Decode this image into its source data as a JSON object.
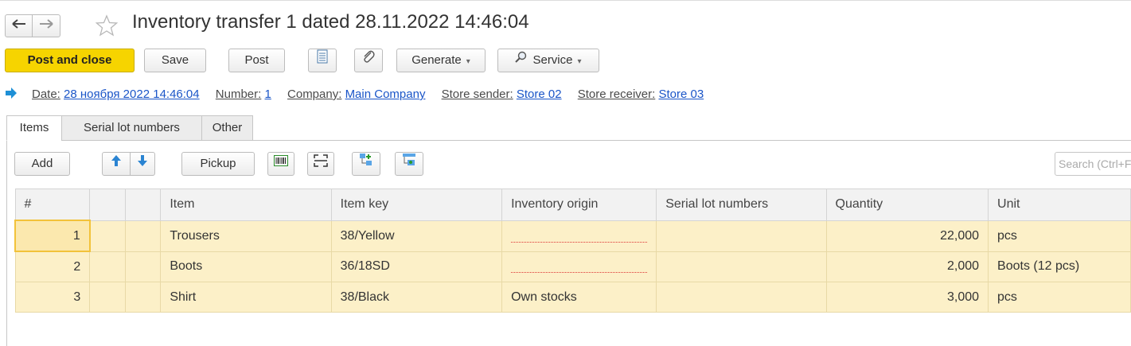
{
  "window": {
    "title": "Inventory transfer 1 dated 28.11.2022 14:46:04"
  },
  "nav": {
    "back_icon": "arrow-left-icon",
    "forward_icon": "arrow-right-icon",
    "favorite_icon": "star-icon"
  },
  "toolbar": {
    "post_and_close": "Post and close",
    "save": "Save",
    "post": "Post",
    "generate": "Generate",
    "service": "Service",
    "report_icon": "document-list-icon",
    "attach_icon": "paperclip-icon",
    "service_icon": "search-icon"
  },
  "header": {
    "date_label": "Date:",
    "date_value": "28 ноября 2022 14:46:04",
    "number_label": "Number:",
    "number_value": "1",
    "company_label": "Company:",
    "company_value": "Main Company",
    "sender_label": "Store sender:",
    "sender_value": "Store 02",
    "receiver_label": "Store receiver:",
    "receiver_value": "Store 03"
  },
  "tabs": [
    {
      "label": "Items",
      "active": true
    },
    {
      "label": "Serial lot numbers",
      "active": false
    },
    {
      "label": "Other",
      "active": false
    }
  ],
  "items_toolbar": {
    "add": "Add",
    "pickup": "Pickup",
    "search_placeholder": "Search (Ctrl+F)"
  },
  "table": {
    "columns": [
      "#",
      "",
      "",
      "Item",
      "Item key",
      "Inventory origin",
      "Serial lot numbers",
      "Quantity",
      "Unit"
    ],
    "rows": [
      {
        "n": "1",
        "item": "Trousers",
        "key": "38/Yellow",
        "origin": "",
        "serial": "",
        "qty": "22,000",
        "unit": "pcs"
      },
      {
        "n": "2",
        "item": "Boots",
        "key": "36/18SD",
        "origin": "",
        "serial": "",
        "qty": "2,000",
        "unit": "Boots (12 pcs)"
      },
      {
        "n": "3",
        "item": "Shirt",
        "key": "38/Black",
        "origin": "Own stocks",
        "serial": "",
        "qty": "3,000",
        "unit": "pcs"
      }
    ]
  },
  "colors": {
    "primary_button": "#f6d400",
    "row_fill": "#fcf0c8",
    "link": "#1a55c8",
    "arrow_accent": "#1e90d6"
  }
}
